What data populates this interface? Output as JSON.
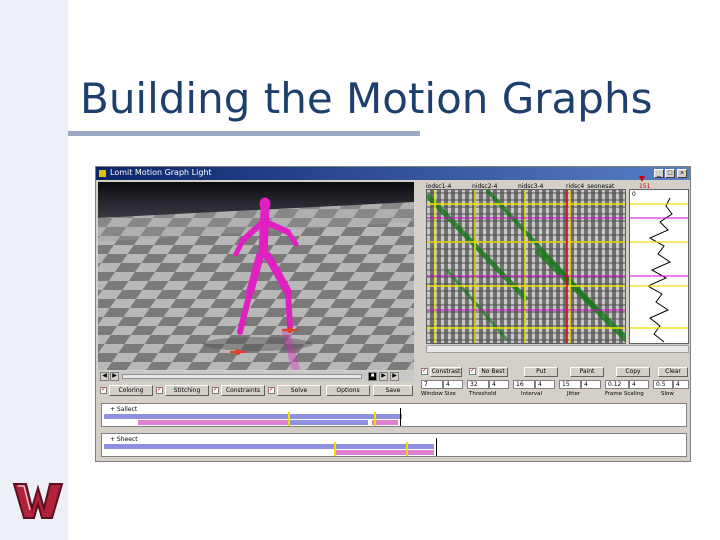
{
  "slide": {
    "title": "Building the Motion Graphs"
  },
  "logo": {
    "icon": "w-logo-icon",
    "text": "W"
  },
  "window": {
    "title": "Lomit Motion Graph Light",
    "minimize": "_",
    "maximize": "□",
    "close": "×"
  },
  "matrix_tabs": [
    "iodsc1-4",
    "nidsc2-4",
    "nidsc3-4",
    "ridsc4_seonesat"
  ],
  "matrix_marker": "151",
  "curve_label": "0",
  "seek": {
    "prev": "◀",
    "next": "▶",
    "stop": "■",
    "play": "▶"
  },
  "toolbar": [
    {
      "label": "Coloring",
      "checked": true
    },
    {
      "label": "Stitching",
      "checked": true
    },
    {
      "label": "Constraints",
      "checked": true
    },
    {
      "label": "Solve",
      "checked": true
    },
    {
      "label": "Options",
      "checked": false
    },
    {
      "label": "Save",
      "checked": false
    }
  ],
  "controls": {
    "checks": [
      {
        "label": "Constrast",
        "checked": true
      },
      {
        "label": "No Best",
        "checked": true
      }
    ],
    "buttons": [
      "Put",
      "Paint",
      "Copy",
      "Clear"
    ],
    "inputs": [
      {
        "value": "7",
        "spin": "4"
      },
      {
        "value": "32",
        "spin": "4"
      },
      {
        "value": "16",
        "spin": "4"
      },
      {
        "value": "15",
        "spin": "4"
      },
      {
        "value": "0.12",
        "spin": "4"
      },
      {
        "value": "0.5",
        "spin": "4"
      }
    ],
    "labels": [
      "Window Size",
      "Threshold",
      "Interval",
      "Jitter",
      "Frame Scaling",
      "Slow"
    ]
  },
  "timelines": [
    {
      "label": "+ Sallect"
    },
    {
      "label": "+ Sheect"
    }
  ],
  "colors": {
    "figure": "#e020c0",
    "accent_yellow": "#f0e000",
    "timeline_blue": "#9090e0",
    "timeline_pink": "#e080d0",
    "title_blue": "#1d3f6e"
  }
}
